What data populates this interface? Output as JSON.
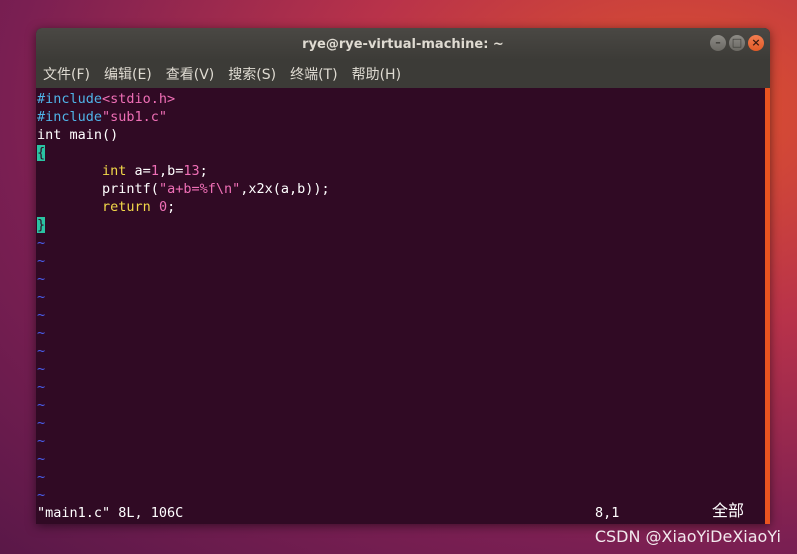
{
  "window": {
    "title": "rye@rye-virtual-machine: ~",
    "buttons": {
      "minimize": "–",
      "maximize": "□",
      "close": "×"
    }
  },
  "menubar": [
    "文件(F)",
    "编辑(E)",
    "查看(V)",
    "搜索(S)",
    "终端(T)",
    "帮助(H)"
  ],
  "code": {
    "line1": {
      "directive": "#include",
      "target": "<stdio.h>"
    },
    "line2": {
      "directive": "#include",
      "target": "\"sub1.c\""
    },
    "line3": "int main()",
    "line4": "{",
    "line5": {
      "indent": "        ",
      "type": "int",
      "a_part": " a=",
      "a_val": "1",
      "b_part": ",b=",
      "b_val": "13",
      "end": ";"
    },
    "line6": {
      "indent": "        ",
      "call": "printf(",
      "fmt": "\"a+b=%f\\n\"",
      "rest": ",x2x(a,b));"
    },
    "line7": {
      "indent": "        ",
      "kw": "return",
      "space": " ",
      "val": "0",
      "end": ";"
    },
    "line8": "}"
  },
  "tilde": "~",
  "status": {
    "file": "\"main1.c\" 8L, 106C",
    "position": "8,1",
    "scroll": "全部"
  },
  "watermark": "CSDN @XiaoYiDeXiaoYi",
  "colors": {
    "terminal_bg": "#300a24",
    "preprocessor": "#4fb4e8",
    "string": "#ef6fb6",
    "keyword": "#f2d949",
    "brace_highlight": "#2ac3a3",
    "tilde": "#4a5ff0",
    "accent": "#e95420"
  }
}
